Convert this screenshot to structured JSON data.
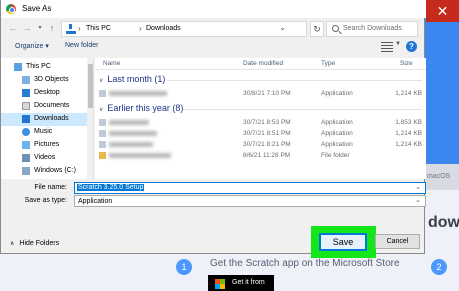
{
  "background": {
    "close_glyph": "✕",
    "os_chip": "macOS",
    "heading": "dow",
    "store_text": "Get the Scratch app on the Microsoft Store",
    "steps": [
      "1",
      "2"
    ],
    "badge_text": "Get it from"
  },
  "dialog": {
    "title": "Save As",
    "address": {
      "crumbs": [
        "This PC",
        "Downloads"
      ]
    },
    "search": {
      "placeholder": "Search Downloads"
    },
    "toolbar": {
      "organize": "Organize ▾",
      "new_folder": "New folder",
      "help": "?"
    },
    "nav_items": [
      {
        "label": "This PC",
        "icon": "computer-icon",
        "selected": false
      },
      {
        "label": "3D Objects",
        "icon": "folder-3d-icon",
        "selected": false
      },
      {
        "label": "Desktop",
        "icon": "desktop-icon",
        "selected": false
      },
      {
        "label": "Documents",
        "icon": "documents-icon",
        "selected": false
      },
      {
        "label": "Downloads",
        "icon": "download-icon",
        "selected": true
      },
      {
        "label": "Music",
        "icon": "music-icon",
        "selected": false
      },
      {
        "label": "Pictures",
        "icon": "pictures-icon",
        "selected": false
      },
      {
        "label": "Videos",
        "icon": "videos-icon",
        "selected": false
      },
      {
        "label": "Windows (C:)",
        "icon": "drive-icon",
        "selected": false
      }
    ],
    "columns": {
      "name": "Name",
      "date": "Date modified",
      "type": "Type",
      "size": "Size"
    },
    "groups": [
      {
        "label": "Last month (1)",
        "rows": [
          {
            "date": "30/8/21 7:10 PM",
            "type": "Application",
            "size": "1,214 KB",
            "folder": false
          }
        ]
      },
      {
        "label": "Earlier this year (8)",
        "rows": [
          {
            "date": "30/7/21 8:53 PM",
            "type": "Application",
            "size": "1,853 KB",
            "folder": false
          },
          {
            "date": "30/7/21 8:51 PM",
            "type": "Application",
            "size": "1,214 KB",
            "folder": false
          },
          {
            "date": "30/7/21 8:21 PM",
            "type": "Application",
            "size": "1,214 KB",
            "folder": false
          },
          {
            "date": "8/6/21 11:28 PM",
            "type": "File folder",
            "size": "",
            "folder": true
          }
        ]
      }
    ],
    "file_name": {
      "label": "File name:",
      "value": "Scratch 3.25.0 Setup"
    },
    "save_as_type": {
      "label": "Save as type:",
      "value": "Application"
    },
    "hide_folders": "Hide Folders",
    "save_button": "Save",
    "cancel_button": "Cancel"
  },
  "colors": {
    "accent": "#0078d7",
    "highlight": "#14e61a",
    "scratch_blue": "#4d97ff"
  }
}
